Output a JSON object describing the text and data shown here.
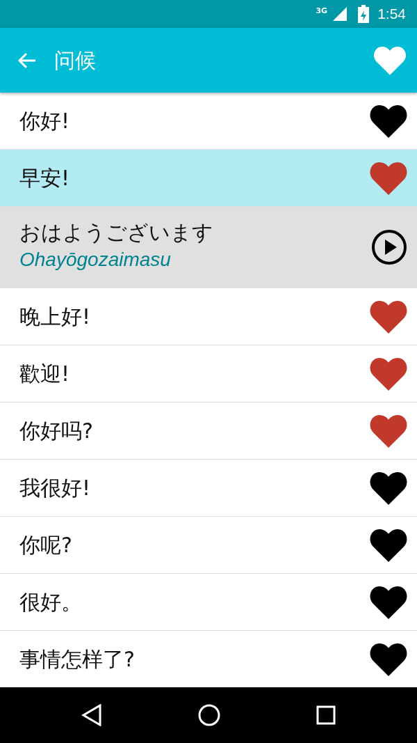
{
  "status_bar": {
    "network": "3G",
    "time": "1:54"
  },
  "app_bar": {
    "title": "问候"
  },
  "items": [
    {
      "kind": "phrase",
      "text": "你好!",
      "favorite": false,
      "selected": false
    },
    {
      "kind": "phrase",
      "text": "早安!",
      "favorite": true,
      "selected": true
    },
    {
      "kind": "translation",
      "text": "おはようございます",
      "translation": "Ohayōgozaimasu",
      "selected": false
    },
    {
      "kind": "phrase",
      "text": "晚上好!",
      "favorite": true,
      "selected": false
    },
    {
      "kind": "phrase",
      "text": "歡迎!",
      "favorite": true,
      "selected": false
    },
    {
      "kind": "phrase",
      "text": "你好吗?",
      "favorite": true,
      "selected": false
    },
    {
      "kind": "phrase",
      "text": "我很好!",
      "favorite": false,
      "selected": false
    },
    {
      "kind": "phrase",
      "text": "你呢?",
      "favorite": false,
      "selected": false
    },
    {
      "kind": "phrase",
      "text": "很好。",
      "favorite": false,
      "selected": false
    },
    {
      "kind": "phrase",
      "text": "事情怎样了?",
      "favorite": false,
      "selected": false
    }
  ]
}
